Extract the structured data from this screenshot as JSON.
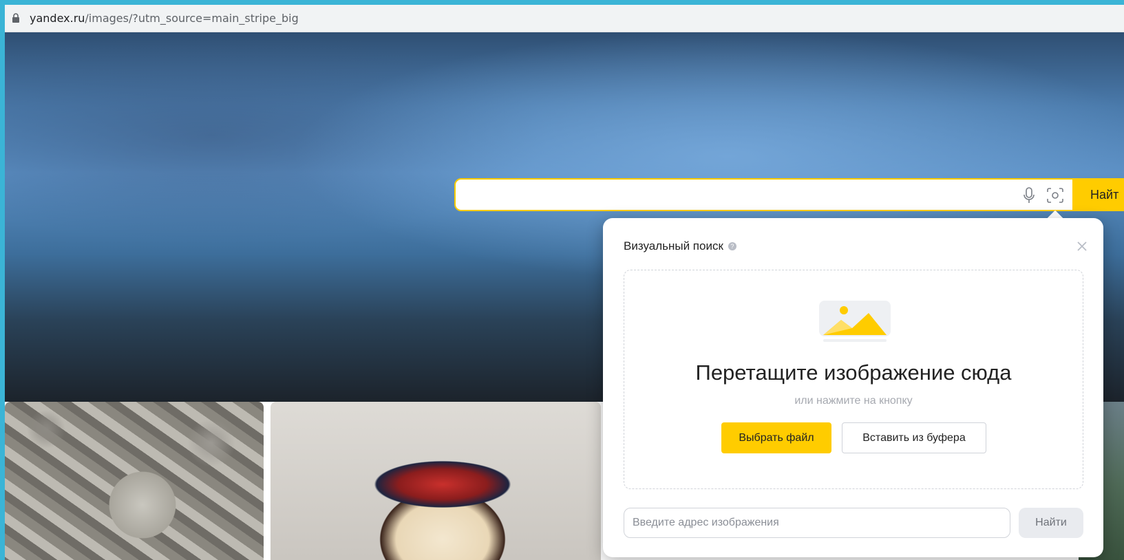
{
  "browser": {
    "url_host": "yandex.ru",
    "url_path": "/images/?utm_source=main_stripe_big"
  },
  "search": {
    "query": "",
    "submit_label": "Найт"
  },
  "visual_search": {
    "title": "Визуальный поиск",
    "info_glyph": "?",
    "dropzone_title": "Перетащите изображение сюда",
    "dropzone_subtitle": "или нажмите на кнопку",
    "choose_file_label": "Выбрать файл",
    "paste_label": "Вставить из буфера",
    "url_placeholder": "Введите адрес изображения",
    "find_label": "Найти"
  },
  "colors": {
    "accent": "#ffcc00",
    "frame": "#3bb4d6"
  }
}
